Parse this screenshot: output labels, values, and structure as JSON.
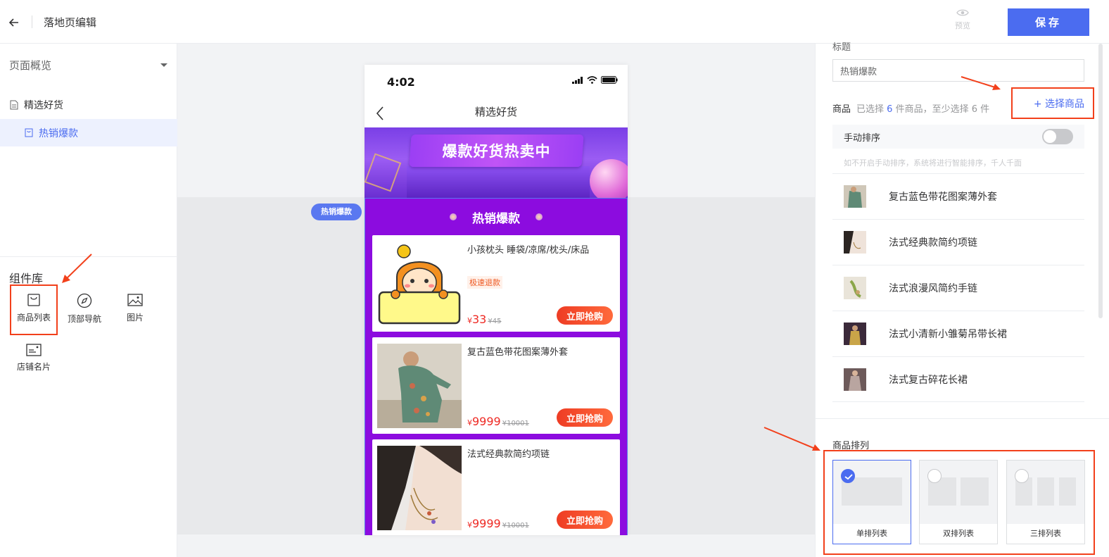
{
  "header": {
    "title": "落地页编辑",
    "preview_label": "预览",
    "save_label": "保存"
  },
  "sidebar": {
    "overview_label": "页面概览",
    "pages": [
      {
        "label": "精选好货"
      },
      {
        "label": "热销爆款"
      }
    ],
    "library_title": "组件库",
    "components": [
      {
        "label": "商品列表",
        "icon": "bag-icon"
      },
      {
        "label": "顶部导航",
        "icon": "compass-icon"
      },
      {
        "label": "图片",
        "icon": "image-icon"
      },
      {
        "label": "店铺名片",
        "icon": "card-icon"
      }
    ]
  },
  "canvas": {
    "section_tag": "热销爆款",
    "phone": {
      "time": "4:02",
      "nav_title": "精选好货",
      "banner_text": "爆款好货热卖中",
      "section_title": "热销爆款",
      "cards": [
        {
          "name": "小孩枕头 睡袋/凉席/枕头/床品",
          "tag": "极速退款",
          "currency": "¥",
          "price": "33",
          "orig_price": "¥45",
          "buy_label": "立即抢购"
        },
        {
          "name": "复古蓝色带花图案薄外套",
          "tag": "",
          "currency": "¥",
          "price": "9999",
          "orig_price": "¥10001",
          "buy_label": "立即抢购"
        },
        {
          "name": "法式经典款简约项链",
          "tag": "",
          "currency": "¥",
          "price": "9999",
          "orig_price": "¥10001",
          "buy_label": "立即抢购"
        }
      ]
    }
  },
  "right_panel": {
    "title_label": "标题",
    "title_value": "热销爆款",
    "goods_label": "商品",
    "goods_hint_prefix": "已选择",
    "goods_count": "6",
    "goods_hint_suffix": "件商品，至少选择 6 件",
    "select_goods_label": "+ 选择商品",
    "manual_sort_label": "手动排序",
    "manual_sort_on": false,
    "sort_hint": "如不开启手动排序，系统将进行智能排序，千人千面",
    "goods": [
      {
        "name": "复古蓝色带花图案薄外套"
      },
      {
        "name": "法式经典款简约项链"
      },
      {
        "name": "法式浪漫风简约手链"
      },
      {
        "name": "法式小清新小雏菊吊带长裙"
      },
      {
        "name": "法式复古碎花长裙"
      }
    ],
    "layout_title": "商品排列",
    "layouts": [
      {
        "label": "单排列表",
        "selected": true
      },
      {
        "label": "双排列表",
        "selected": false
      },
      {
        "label": "三排列表",
        "selected": false
      }
    ]
  },
  "colors": {
    "accent": "#4b6cf0",
    "annotation": "#f2401b",
    "section_bg": "#8c0cdf",
    "price": "#ee2a24"
  }
}
